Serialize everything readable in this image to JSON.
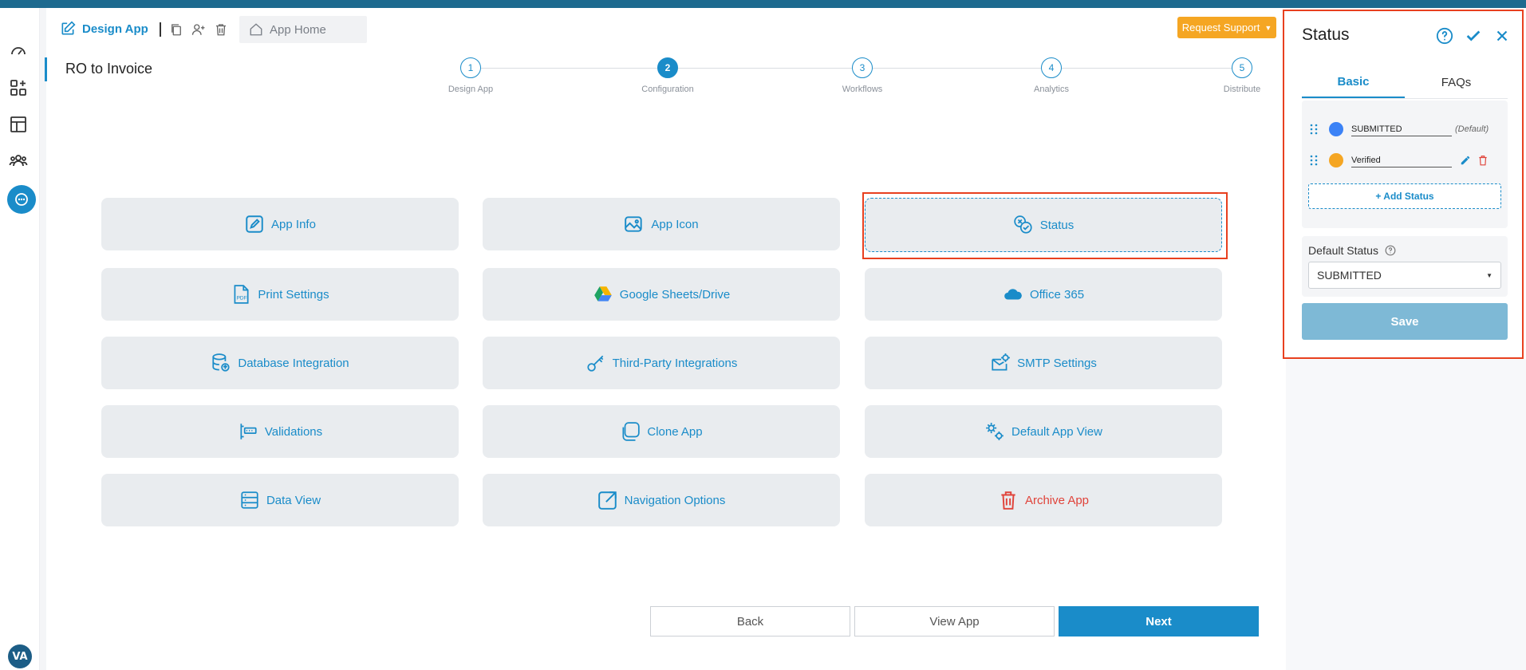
{
  "header": {
    "design_app": "Design App",
    "app_home": "App Home",
    "request_support": "Request Support",
    "page_title": "RO to Invoice"
  },
  "stepper": {
    "steps": [
      {
        "num": "1",
        "label": "Design App"
      },
      {
        "num": "2",
        "label": "Configuration"
      },
      {
        "num": "3",
        "label": "Workflows"
      },
      {
        "num": "4",
        "label": "Analytics"
      },
      {
        "num": "5",
        "label": "Distribute"
      }
    ],
    "active_step": 2
  },
  "tiles": [
    {
      "label": "App Info",
      "icon": "edit-icon"
    },
    {
      "label": "App Icon",
      "icon": "image-icon"
    },
    {
      "label": "Status",
      "icon": "status-icon"
    },
    {
      "label": "Print Settings",
      "icon": "pdf-icon"
    },
    {
      "label": "Google Sheets/Drive",
      "icon": "google-drive-icon"
    },
    {
      "label": "Office 365",
      "icon": "cloud-icon"
    },
    {
      "label": "Database Integration",
      "icon": "database-icon"
    },
    {
      "label": "Third-Party Integrations",
      "icon": "key-icon"
    },
    {
      "label": "SMTP Settings",
      "icon": "mail-gear-icon"
    },
    {
      "label": "Validations",
      "icon": "validation-icon"
    },
    {
      "label": "Clone App",
      "icon": "clone-icon"
    },
    {
      "label": "Default App View",
      "icon": "gears-icon"
    },
    {
      "label": "Data View",
      "icon": "list-icon"
    },
    {
      "label": "Navigation Options",
      "icon": "external-link-icon"
    },
    {
      "label": "Archive App",
      "icon": "trash-icon"
    }
  ],
  "bottom": {
    "back": "Back",
    "view_app": "View App",
    "next": "Next"
  },
  "panel": {
    "title": "Status",
    "tabs": [
      "Basic",
      "FAQs"
    ],
    "statuses": [
      {
        "name": "SUBMITTED",
        "color": "#3b82f6",
        "tag": "(Default)"
      },
      {
        "name": "Verified",
        "color": "#f5a623",
        "tag": ""
      }
    ],
    "add_status": "+ Add Status",
    "default_status_label": "Default Status",
    "default_status_value": "SUBMITTED",
    "save": "Save"
  },
  "user": {
    "initials": "VA"
  },
  "colors": {
    "accent": "#1a8cc9",
    "warning": "#f5a623",
    "danger": "#e0433a",
    "highlight": "#e8401f"
  }
}
